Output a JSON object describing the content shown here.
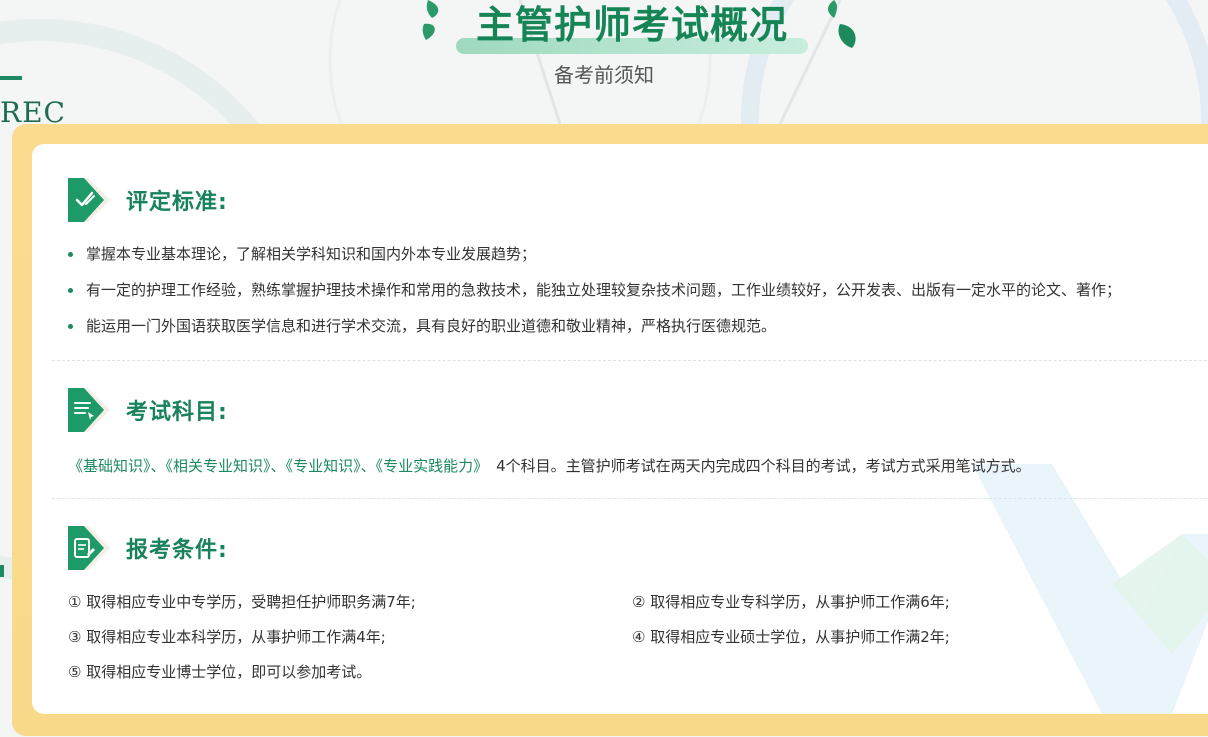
{
  "header": {
    "title": "主管护师考试概况",
    "subtitle": "备考前须知"
  },
  "side": {
    "logo_text": "REC"
  },
  "sections": {
    "criteria": {
      "title": "评定标准:",
      "icon": "checkmark-pen-icon",
      "items": [
        "掌握本专业基本理论，了解相关学科知识和国内外本专业发展趋势；",
        "有一定的护理工作经验，熟练掌握护理技术操作和常用的急救技术，能独立处理较复杂技术问题，工作业绩较好，公开发表、出版有一定水平的论文、著作；",
        "能运用一门外国语获取医学信息和进行学术交流，具有良好的职业道德和敬业精神，严格执行医德规范。"
      ]
    },
    "subjects": {
      "title": "考试科目:",
      "icon": "document-list-icon",
      "items": [
        "《基础知识》",
        "《相关专业知识》",
        "《专业知识》",
        "《专业实践能力》"
      ],
      "separator": "、",
      "description": "4个科目。主管护师考试在两天内完成四个科目的考试，考试方式采用笔试方式。"
    },
    "conditions": {
      "title": "报考条件:",
      "icon": "clipboard-pen-icon",
      "items": [
        "① 取得相应专业中专学历，受聘担任护师职务满7年;",
        "② 取得相应专业专科学历，从事护师工作满6年;",
        "③ 取得相应专业本科学历，从事护师工作满4年;",
        "④ 取得相应专业硕士学位，从事护师工作满2年;",
        "⑤ 取得相应专业博士学位，即可以参加考试。"
      ]
    }
  },
  "colors": {
    "brand_green": "#158556",
    "card_border": "#fbdc8f",
    "icon_green": "#1e9a68"
  }
}
